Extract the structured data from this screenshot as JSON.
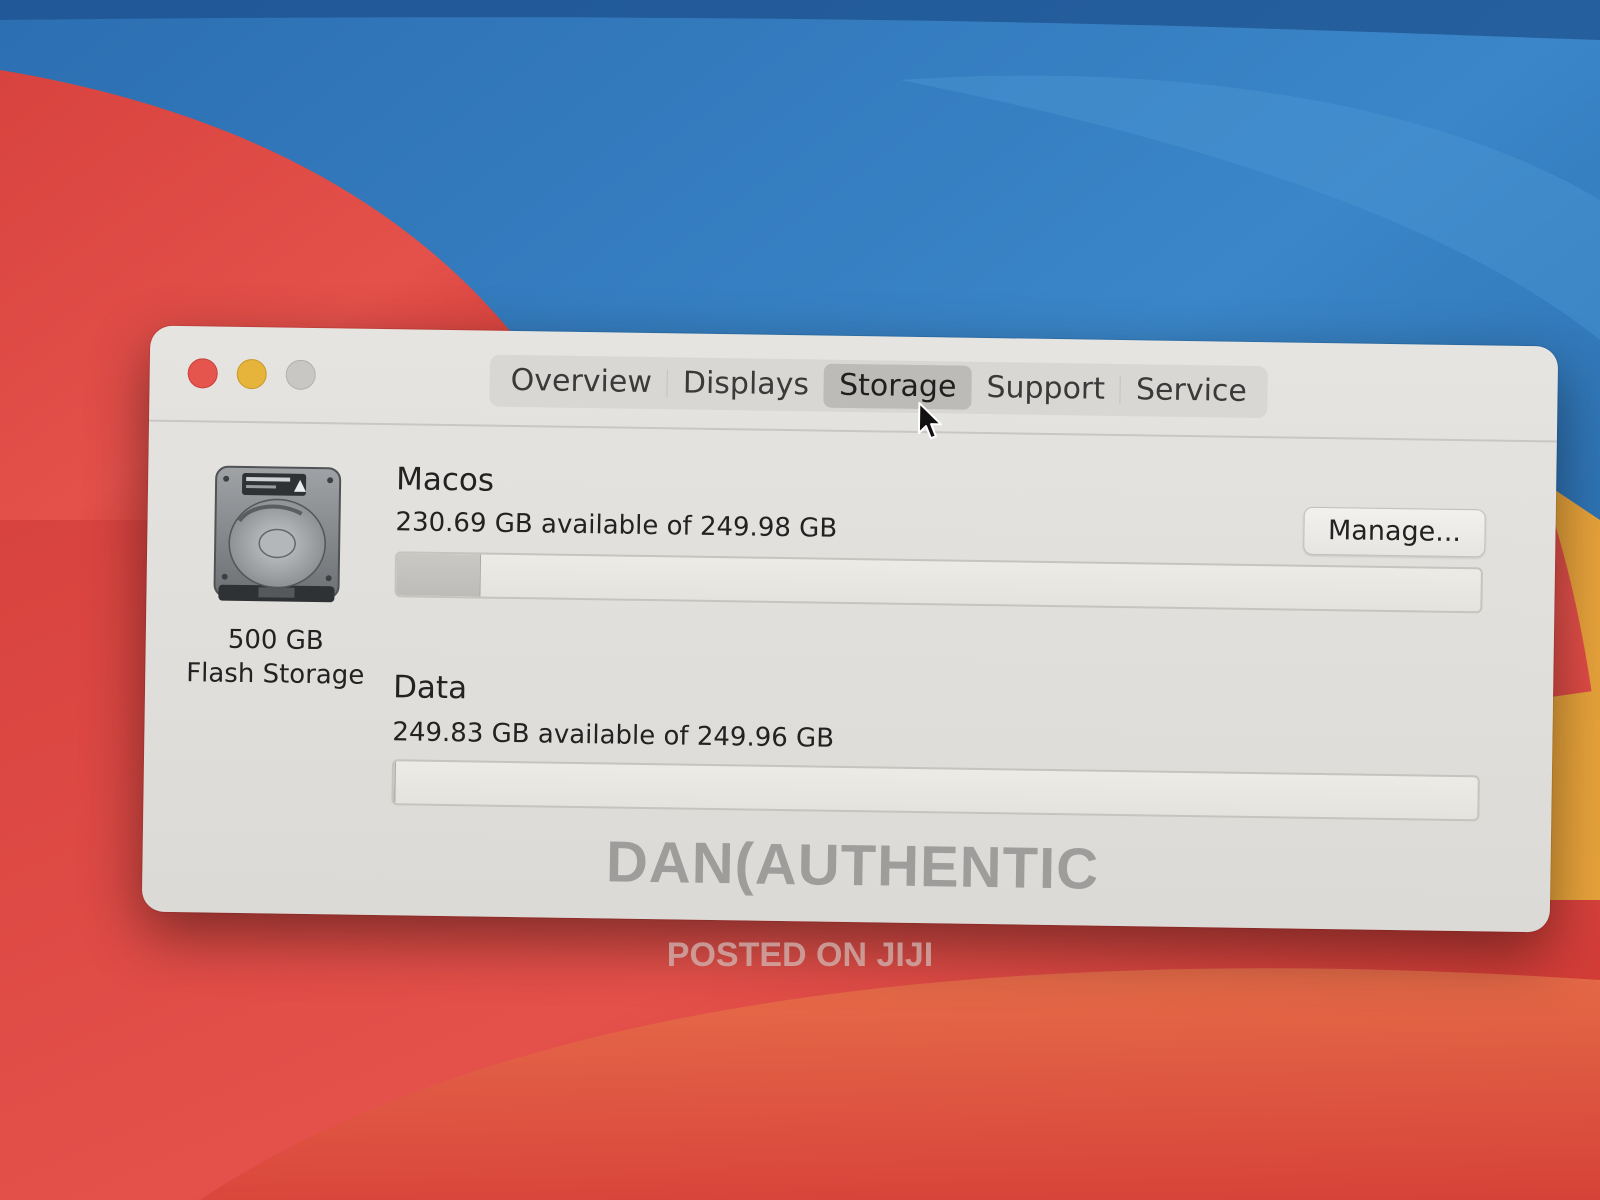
{
  "window": {
    "tabs": [
      {
        "label": "Overview",
        "selected": false
      },
      {
        "label": "Displays",
        "selected": false
      },
      {
        "label": "Storage",
        "selected": true
      },
      {
        "label": "Support",
        "selected": false
      },
      {
        "label": "Service",
        "selected": false
      }
    ],
    "traffic_lights": {
      "close_color": "#e5544d",
      "minimize_color": "#e6b43b",
      "maximize_color": "#c9c7c3"
    }
  },
  "drive": {
    "icon": "hard-drive-icon",
    "size": "500 GB",
    "type": "Flash Storage"
  },
  "volumes": [
    {
      "name": "Macos",
      "info": "230.69 GB available of 249.98 GB",
      "used_fraction": 0.077
    },
    {
      "name": "Data",
      "info": "249.83 GB available of 249.96 GB",
      "used_fraction": 0.0005
    }
  ],
  "manage_button": {
    "label": "Manage..."
  },
  "watermark": {
    "main": "DAN(AUTHENTIC",
    "sub": "POSTED ON JIJI"
  }
}
